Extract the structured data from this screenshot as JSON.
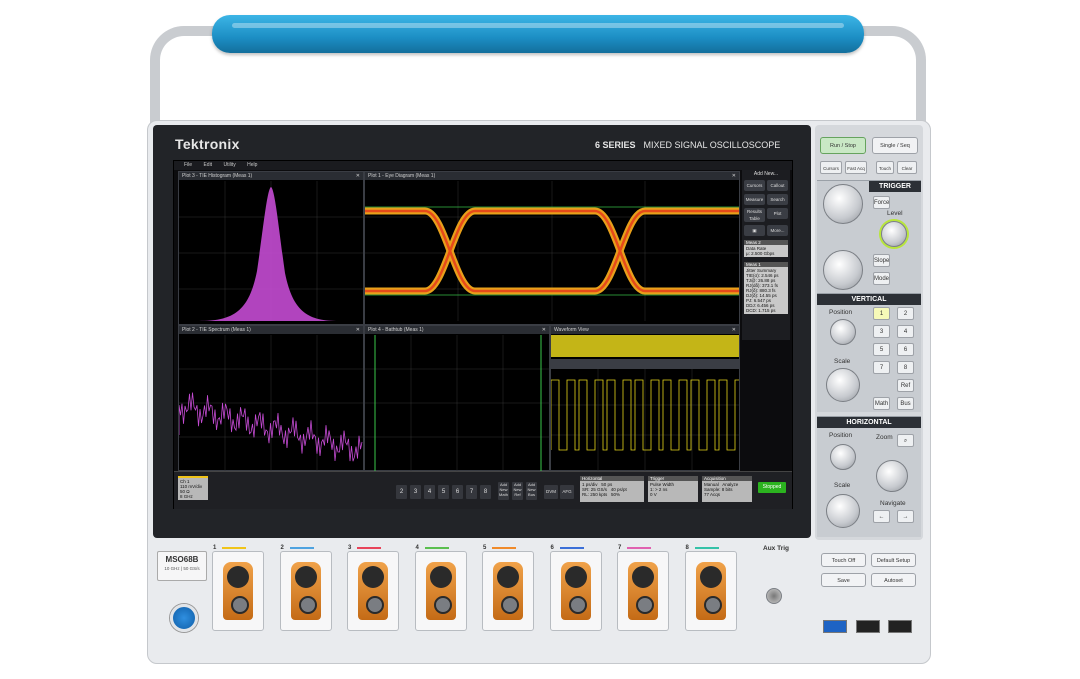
{
  "brand": "Tektronix",
  "series": "6 SERIES",
  "series_desc": "MIXED SIGNAL OSCILLOSCOPE",
  "menu": [
    "File",
    "Edit",
    "Utility",
    "Help"
  ],
  "panes": {
    "tie_hist": "Plot 3 - TIE Histogram (Meas 1)",
    "eye": "Plot 1 - Eye Diagram (Meas 1)",
    "tie_spec": "Plot 2 - TIE Spectrum (Meas 1)",
    "bathtub": "Plot 4 - Bathtub (Meas 1)",
    "waveform": "Waveform View"
  },
  "side": {
    "add_new": "Add New...",
    "buttons": [
      "Cursors",
      "Callout",
      "Measure",
      "Search",
      "Results Table",
      "Plot",
      "",
      "More..."
    ],
    "meas2_title": "Meas 2",
    "meas2_lines": [
      "Data Rate",
      "μ: 2.500 Gbps"
    ],
    "meas1_title": "Meas 1",
    "meas1_lines": [
      "Jitter Summary",
      "TIE(σ): 2.546 ps",
      "TJ@: 26.88 ps",
      "RJ(dδ): 373.1 fs",
      "RJ(δ): 880.3 fs",
      "DJ(δ): 14.55 ps",
      "PJ: 6.547 ps",
      "DDJ: 6.456 ps",
      "DCD: 1.715 ps"
    ]
  },
  "bottom": {
    "ch1": [
      "Ch 1",
      "110 mV/div",
      "50 Ω",
      "8 GHz"
    ],
    "channels": [
      "2",
      "3",
      "4",
      "5",
      "6",
      "7",
      "8"
    ],
    "adds": [
      "Add New Math",
      "Add New Ref",
      "Add New Bus"
    ],
    "dvm": "DVM",
    "afg": "AFG",
    "horizontal": [
      "Horizontal",
      "1 ps/div",
      "SR: 25 GS/s",
      "RL: 250 kpts",
      "50 ps",
      "40 ps/pt",
      "50%"
    ],
    "trigger": [
      "Trigger",
      "Pulse Width",
      "1: > 2 ns",
      "0 V"
    ],
    "acquisition": [
      "Acquisition",
      "Manual",
      "Analyze",
      "Sample: 8 bits",
      "77 Acqs"
    ],
    "status": "Stopped"
  },
  "panel": {
    "run_stop": "Run / Stop",
    "single_seq": "Single / Seq",
    "cursors": "Cursors",
    "fastacq": "Fast Acq",
    "touch": "Touch",
    "clear": "Clear",
    "trigger": "TRIGGER",
    "force": "Force",
    "level": "Level",
    "slope": "Slope",
    "mode": "Mode",
    "vertical": "VERTICAL",
    "position": "Position",
    "scale": "Scale",
    "ch_buttons": [
      "1",
      "2",
      "3",
      "4",
      "5",
      "6",
      "7",
      "8"
    ],
    "ref": "Ref",
    "math": "Math",
    "bus": "Bus",
    "horizontal": "HORIZONTAL",
    "zoom": "Zoom",
    "navigate": "Navigate",
    "touch_off": "Touch Off",
    "default_setup": "Default Setup",
    "save": "Save",
    "autoset": "Autoset",
    "aux_trig": "Aux Trig"
  },
  "front": {
    "model": "MSO68B",
    "model_sub": [
      "10 GHz",
      "50 GS/s"
    ],
    "probes": [
      {
        "num": "1",
        "color": "#f0c419"
      },
      {
        "num": "2",
        "color": "#4fa3e0"
      },
      {
        "num": "3",
        "color": "#e8445a"
      },
      {
        "num": "4",
        "color": "#5bbf4f"
      },
      {
        "num": "5",
        "color": "#f08a2a"
      },
      {
        "num": "6",
        "color": "#3b6fd8"
      },
      {
        "num": "7",
        "color": "#e062b0"
      },
      {
        "num": "8",
        "color": "#35c2a8"
      }
    ]
  },
  "colors": {
    "handle": "#1c8ec4",
    "stopped": "#2bb31f",
    "histogram": "#c44bd3",
    "waveform": "#e6d51b"
  }
}
